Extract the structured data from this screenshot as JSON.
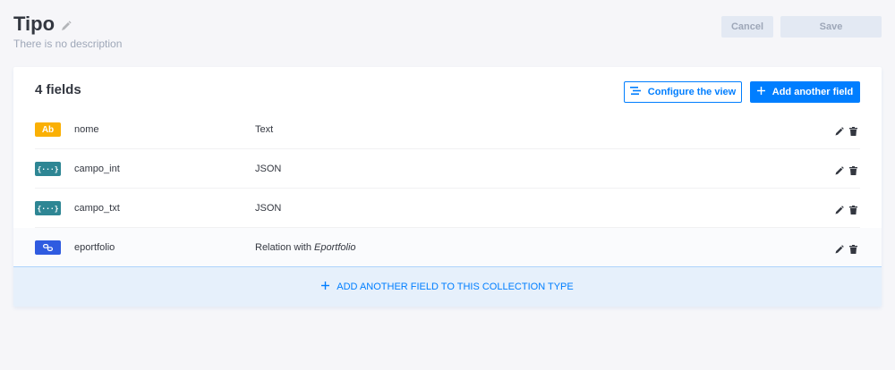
{
  "header": {
    "title": "Tipo",
    "description": "There is no description",
    "cancel_label": "Cancel",
    "save_label": "Save"
  },
  "list": {
    "count_label": "4 fields",
    "configure_label": "Configure the view",
    "add_label": "Add another field",
    "fields": [
      {
        "badge": "Ab",
        "name": "nome",
        "type": "Text"
      },
      {
        "badge": "{···}",
        "name": "campo_int",
        "type": "JSON"
      },
      {
        "badge": "{···}",
        "name": "campo_txt",
        "type": "JSON"
      },
      {
        "badge": "link",
        "name": "eportfolio",
        "type_prefix": "Relation with",
        "type_target": "Eportfolio"
      }
    ],
    "add_collection_label": "ADD ANOTHER FIELD TO THIS COLLECTION TYPE"
  },
  "colors": {
    "accent": "#007eff",
    "badge_text": "#fab005",
    "badge_json": "#2e8694",
    "badge_relation": "#2f5be0"
  }
}
